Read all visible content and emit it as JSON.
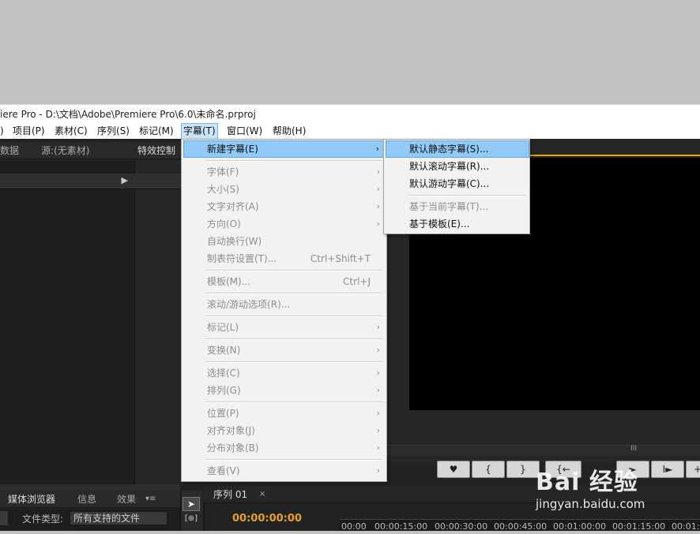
{
  "window": {
    "title": "iere Pro - D:\\文档\\Adobe\\Premiere Pro\\6.0\\未命名.prproj"
  },
  "menubar": [
    {
      "label": ")"
    },
    {
      "label": "项目(P)"
    },
    {
      "label": "素材(C)"
    },
    {
      "label": "序列(S)"
    },
    {
      "label": "标记(M)"
    },
    {
      "label": "字幕(T)"
    },
    {
      "label": "窗口(W)"
    },
    {
      "label": "帮助(H)"
    }
  ],
  "top_tabs": {
    "metadata": "数据",
    "source": "源:(无素材)",
    "effect_controls": "特效控制"
  },
  "title_menu": {
    "items": [
      {
        "label": "新建字幕(E)",
        "submenu": true,
        "highlighted": true
      },
      {
        "label": "字体(F)",
        "submenu": true,
        "disabled": true
      },
      {
        "label": "大小(S)",
        "submenu": true,
        "disabled": true
      },
      {
        "label": "文字对齐(A)",
        "submenu": true,
        "disabled": true
      },
      {
        "label": "方向(O)",
        "submenu": true,
        "disabled": true
      },
      {
        "label": "自动换行(W)",
        "disabled": true
      },
      {
        "label": "制表符设置(T)...",
        "shortcut": "Ctrl+Shift+T",
        "disabled": true
      },
      {
        "label": "模板(M)...",
        "shortcut": "Ctrl+J",
        "disabled": true
      },
      {
        "label": "滚动/游动选项(R)...",
        "disabled": true
      },
      {
        "label": "标记(L)",
        "submenu": true,
        "disabled": true
      },
      {
        "label": "变换(N)",
        "submenu": true,
        "disabled": true
      },
      {
        "label": "选择(C)",
        "submenu": true,
        "disabled": true
      },
      {
        "label": "排列(G)",
        "submenu": true,
        "disabled": true
      },
      {
        "label": "位置(P)",
        "submenu": true,
        "disabled": true
      },
      {
        "label": "对齐对象(J)",
        "submenu": true,
        "disabled": true
      },
      {
        "label": "分布对象(B)",
        "submenu": true,
        "disabled": true
      },
      {
        "label": "查看(V)",
        "submenu": true,
        "disabled": true
      }
    ]
  },
  "new_title_submenu": {
    "items": [
      {
        "label": "默认静态字幕(S)...",
        "highlighted": true
      },
      {
        "label": "默认滚动字幕(R)..."
      },
      {
        "label": "默认游动字幕(C)..."
      },
      {
        "label": "基于当前字幕(T)...",
        "disabled": true
      },
      {
        "label": "基于模板(E)..."
      }
    ]
  },
  "bottom_panel": {
    "tabs": {
      "media_browser": "媒体浏览器",
      "info": "信息",
      "effects": "效果"
    },
    "file_type_label": "文件类型:",
    "file_type_value": "所有支持的文件"
  },
  "sequence": {
    "tab": "序列 01",
    "timecode": "00:00:00:00",
    "ruler": [
      "00:00",
      "00:00:15:00",
      "00:00:30:00",
      "00:00:45:00",
      "00:01:00:00",
      "00:01:15:00",
      "00:01:3"
    ]
  },
  "program_controls": [
    "♥",
    "{",
    "}",
    "{←",
    "►",
    "I►",
    "+"
  ],
  "watermark": {
    "brand": "Bai 经验",
    "url": "jingyan.baidu.com"
  },
  "colors": {
    "accent": "#91c9f7",
    "timecode": "#e8a317",
    "menu_bg": "#f2f2f2"
  }
}
